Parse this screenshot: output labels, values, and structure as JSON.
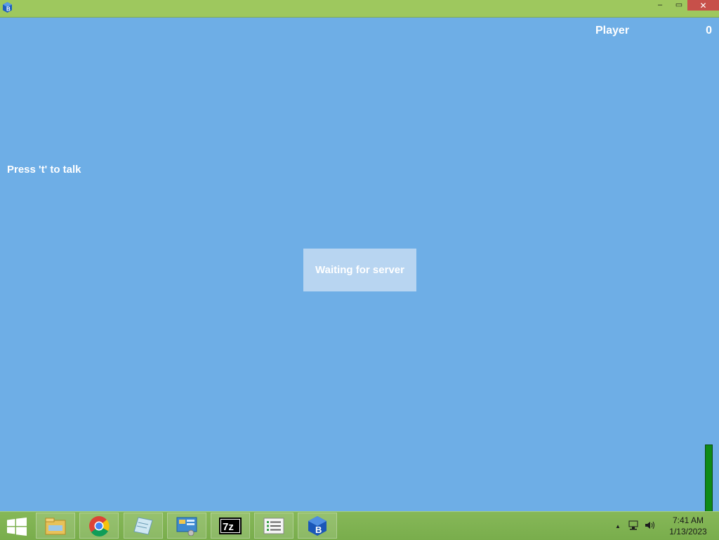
{
  "window": {
    "minimize_label": "–",
    "maximize_label": "▭",
    "close_label": "✕",
    "app_icon": "blue-cube-b-icon"
  },
  "game": {
    "player_name": "Player",
    "player_score": "0",
    "talk_hint": "Press 't' to talk",
    "status_message": "Waiting for server",
    "background_color": "#6eaee6"
  },
  "taskbar": {
    "apps": [
      {
        "name": "file-explorer-icon"
      },
      {
        "name": "chrome-icon"
      },
      {
        "name": "notepad-icon"
      },
      {
        "name": "control-panel-icon"
      },
      {
        "name": "7zip-icon",
        "label": "7z"
      },
      {
        "name": "task-list-icon"
      },
      {
        "name": "blue-cube-b-icon"
      }
    ],
    "tray": {
      "show_hidden_icon": "▲",
      "network_icon": "network-icon",
      "volume_icon": "volume-icon"
    },
    "clock": {
      "time": "7:41 AM",
      "date": "1/13/2023"
    }
  }
}
